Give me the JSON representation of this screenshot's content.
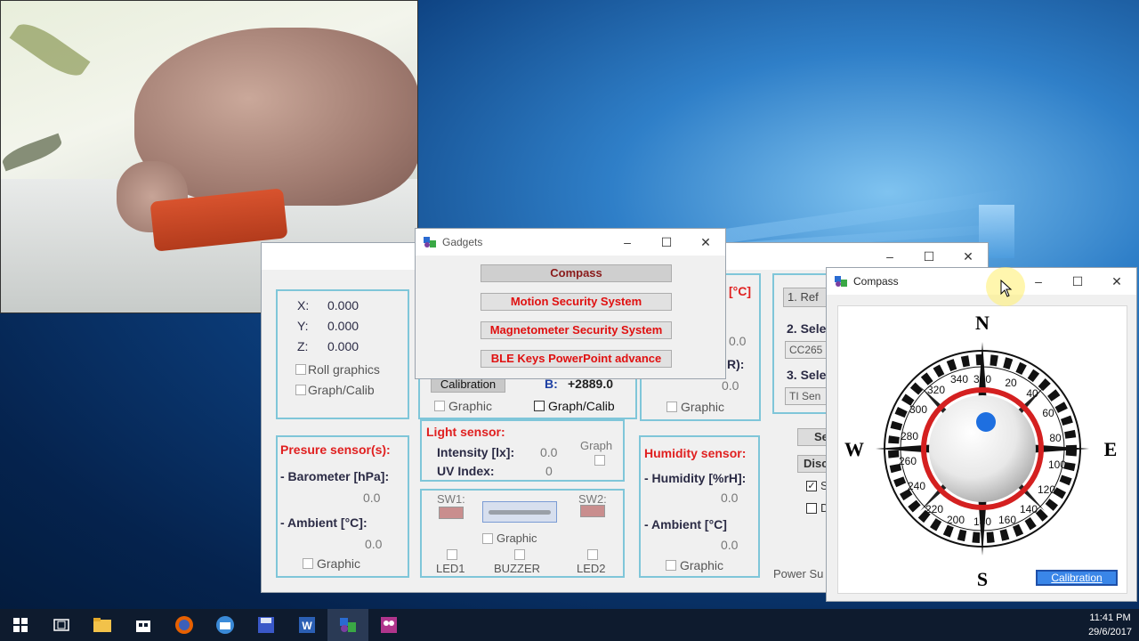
{
  "gadgets_window": {
    "title": "Gadgets",
    "buttons": [
      "Compass",
      "Motion Security System",
      "Magnetometer Security System",
      "BLE Keys PowerPoint advance"
    ]
  },
  "compass_window": {
    "title": "Compass",
    "cardinals": {
      "n": "N",
      "s": "S",
      "e": "E",
      "w": "W"
    },
    "degrees": [
      "340",
      "360",
      "20",
      "40",
      "60",
      "80",
      "100",
      "120",
      "140",
      "160",
      "180",
      "200",
      "220",
      "240",
      "260",
      "280",
      "300",
      "320"
    ],
    "calibration_button": "Calibration"
  },
  "sensor_window": {
    "x_label": "X:",
    "x_value": "0.000",
    "y_label": "Y:",
    "y_value": "0.000",
    "z_label": "Z:",
    "z_value": "0.000",
    "roll_graphics": "Roll graphics",
    "graph_calib_1": "Graph/Calib",
    "calibration_btn": "Calibration",
    "graphic_mid": "Graphic",
    "b_label": "B:",
    "b_value": "+2889.0",
    "graph_calib_2": "Graph/Calib",
    "temp_unit": "[°C]",
    "temp_value": "0.0",
    "ir_label": "R):",
    "ir_value": "0.0",
    "graphic_temp": "Graphic",
    "pressure_title": "Presure sensor(s):",
    "barometer_label": "- Barometer  [hPa]:",
    "barometer_value": "0.0",
    "ambient_label_1": "- Ambient  [°C]:",
    "ambient_value_1": "0.0",
    "graphic_pressure": "Graphic",
    "light_title": "Light sensor:",
    "intensity_label": "Intensity [lx]:",
    "intensity_value": "0.0",
    "uv_label": "UV Index:",
    "uv_value": "0",
    "graph_light": "Graph",
    "sw1": "SW1:",
    "sw2": "SW2:",
    "graphic_switch": "Graphic",
    "led1": "LED1",
    "buzzer": "BUZZER",
    "led2": "LED2",
    "humidity_title": "Humidity sensor:",
    "humidity_label": "- Humidity [%rH]:",
    "humidity_value": "0.0",
    "ambient_label_2": "- Ambient  [°C]",
    "ambient_value_2": "0.0",
    "graphic_humidity": "Graphic",
    "step1": "1. Ref",
    "step2": "2. Sele",
    "device1": "CC265",
    "step3": "3. Sele",
    "device2": "TI Sen",
    "se_btn": "Se",
    "disc_btn": "Disc",
    "s_opt": "S",
    "d_opt": "D",
    "power_label": "Power Su"
  },
  "taskbar": {
    "time": "11:41 PM",
    "date": "29/6/2017"
  },
  "colors": {
    "accent_red": "#e02020",
    "panel_border": "#7fc6d9",
    "compass_ring": "#d42020",
    "marker_blue": "#1e6fe0"
  }
}
